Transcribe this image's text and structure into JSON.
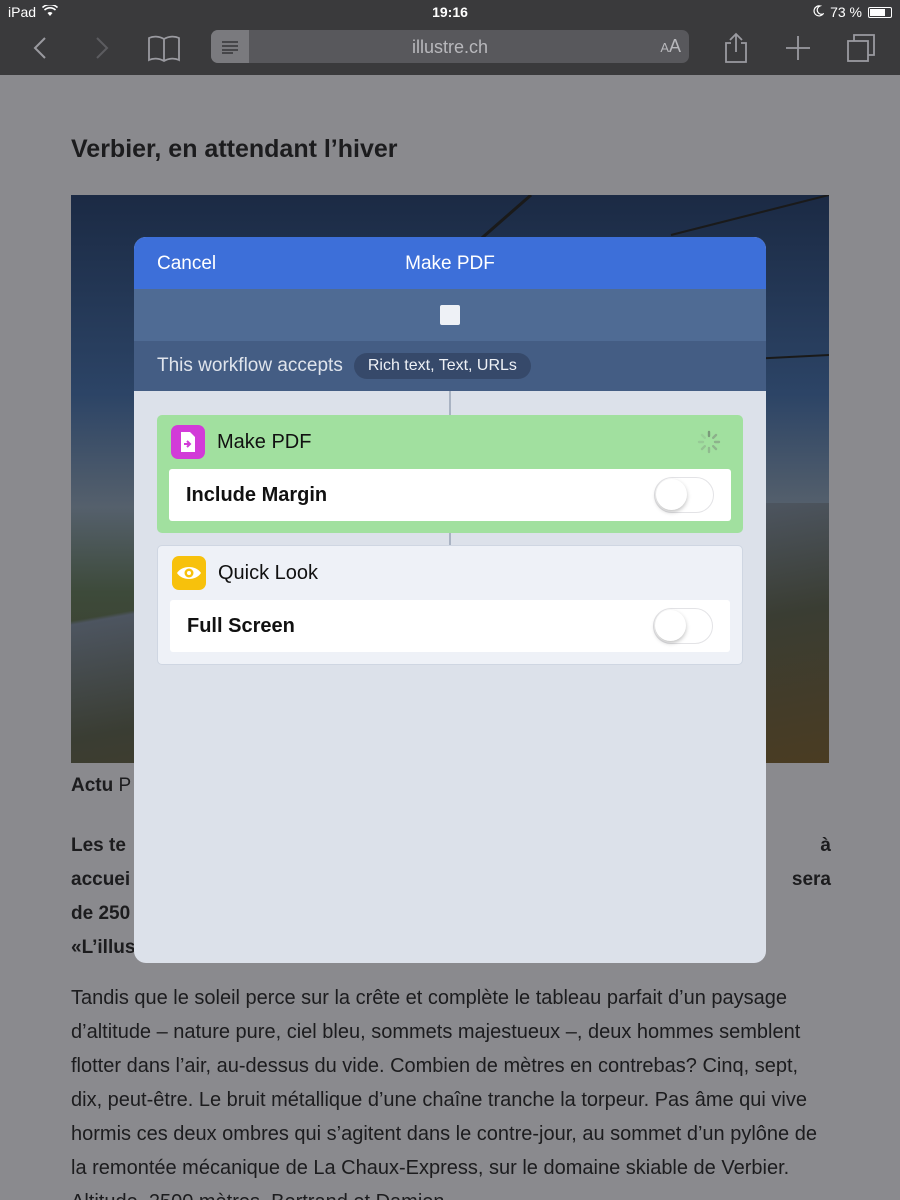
{
  "status_bar": {
    "device": "iPad",
    "time": "19:16",
    "battery_text": "73 %",
    "battery_level": 0.73
  },
  "safari": {
    "url": "illustre.ch",
    "text_size_label": "AA"
  },
  "article": {
    "title": "Verbier, en attendant l’hiver",
    "caption_section": "Actu",
    "caption_rest": "P",
    "lead_lines": [
      {
        "left": "Les te",
        "right": "à"
      },
      {
        "left": "accuei",
        "right": "sera"
      },
      {
        "left": "de 250",
        "right": ""
      },
      {
        "left": "«L’illus",
        "right": ""
      }
    ],
    "body": "Tandis que le soleil perce sur la crête et complète le tableau parfait d’un paysage d’altitude – nature pure, ciel bleu, sommets majestueux –, deux hommes semblent flotter dans l’air, au-dessus du vide. Combien de mètres en contrebas? Cinq, sept, dix, peut-être. Le bruit métallique d’une chaîne tranche la torpeur. Pas âme qui vive hormis ces deux ombres qui s’agitent dans le contre-jour, au sommet d’un pylône de la remontée mécanique de La Chaux-Express, sur le domaine skiable de Verbier. Altitude, 2500 mètres. Bertrand et Damien"
  },
  "sheet": {
    "cancel_label": "Cancel",
    "title": "Make PDF",
    "accepts_label": "This workflow accepts",
    "accepts_types": "Rich text, Text, URLs",
    "actions": [
      {
        "title": "Make PDF",
        "icon": "pdf-document-icon",
        "state": "running",
        "color": "#a1e09f",
        "icon_color": "#d23bd8",
        "param_label": "Include Margin",
        "param_on": false
      },
      {
        "title": "Quick Look",
        "icon": "eye-icon",
        "state": "idle",
        "color": "#eef1f7",
        "icon_color": "#f7c10c",
        "param_label": "Full Screen",
        "param_on": false
      }
    ]
  },
  "colors": {
    "header_blue": "#3d6fd9",
    "dim_overlay": "#8a8a8e"
  }
}
